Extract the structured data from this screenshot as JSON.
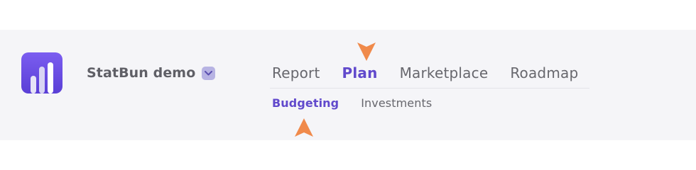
{
  "app": {
    "logo_icon": "bar-chart-logo-icon",
    "workspace_name": "StatBun demo",
    "workspace_dropdown_icon": "chevron-down-icon"
  },
  "nav": {
    "primary_tabs": [
      {
        "label": "Report",
        "active": false
      },
      {
        "label": "Plan",
        "active": true
      },
      {
        "label": "Marketplace",
        "active": false
      },
      {
        "label": "Roadmap",
        "active": false
      }
    ],
    "secondary_tabs": [
      {
        "label": "Budgeting",
        "active": true
      },
      {
        "label": "Investments",
        "active": false
      }
    ]
  },
  "annotations": {
    "pointer_icon": "arrow-pointer-icon",
    "pointer_color": "#f08a4b"
  },
  "colors": {
    "accent": "#6149cc",
    "logo_gradient_start": "#7b5df0",
    "logo_gradient_end": "#5a3fd6",
    "header_background": "#f5f5f8",
    "inactive_text": "#67676d",
    "badge": "#b7b3e3"
  }
}
